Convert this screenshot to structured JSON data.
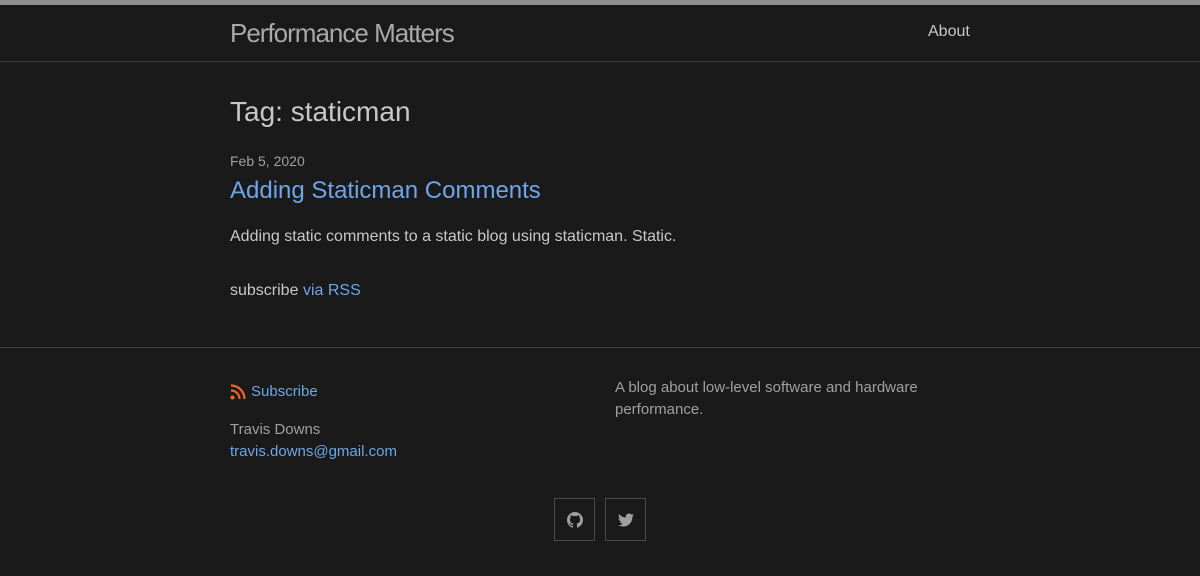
{
  "header": {
    "site_title": "Performance Matters",
    "nav": {
      "about": "About"
    }
  },
  "main": {
    "heading": "Tag: staticman",
    "posts": [
      {
        "date": "Feb 5, 2020",
        "title": "Adding Staticman Comments",
        "excerpt": "Adding static comments to a static blog using staticman. Static."
      }
    ],
    "rss": {
      "prefix": "subscribe",
      "link": "via RSS"
    }
  },
  "footer": {
    "subscribe": "Subscribe",
    "author_name": "Travis Downs",
    "email": "travis.downs@gmail.com",
    "description": "A blog about low-level software and hardware performance.",
    "social": [
      {
        "icon": "github-icon"
      },
      {
        "icon": "twitter-icon"
      }
    ]
  },
  "colors": {
    "background": "#1a1a1a",
    "link": "#6fa5e8",
    "rss": "#f26522",
    "text": "#c8c8c8",
    "muted": "#a0a0a0"
  }
}
